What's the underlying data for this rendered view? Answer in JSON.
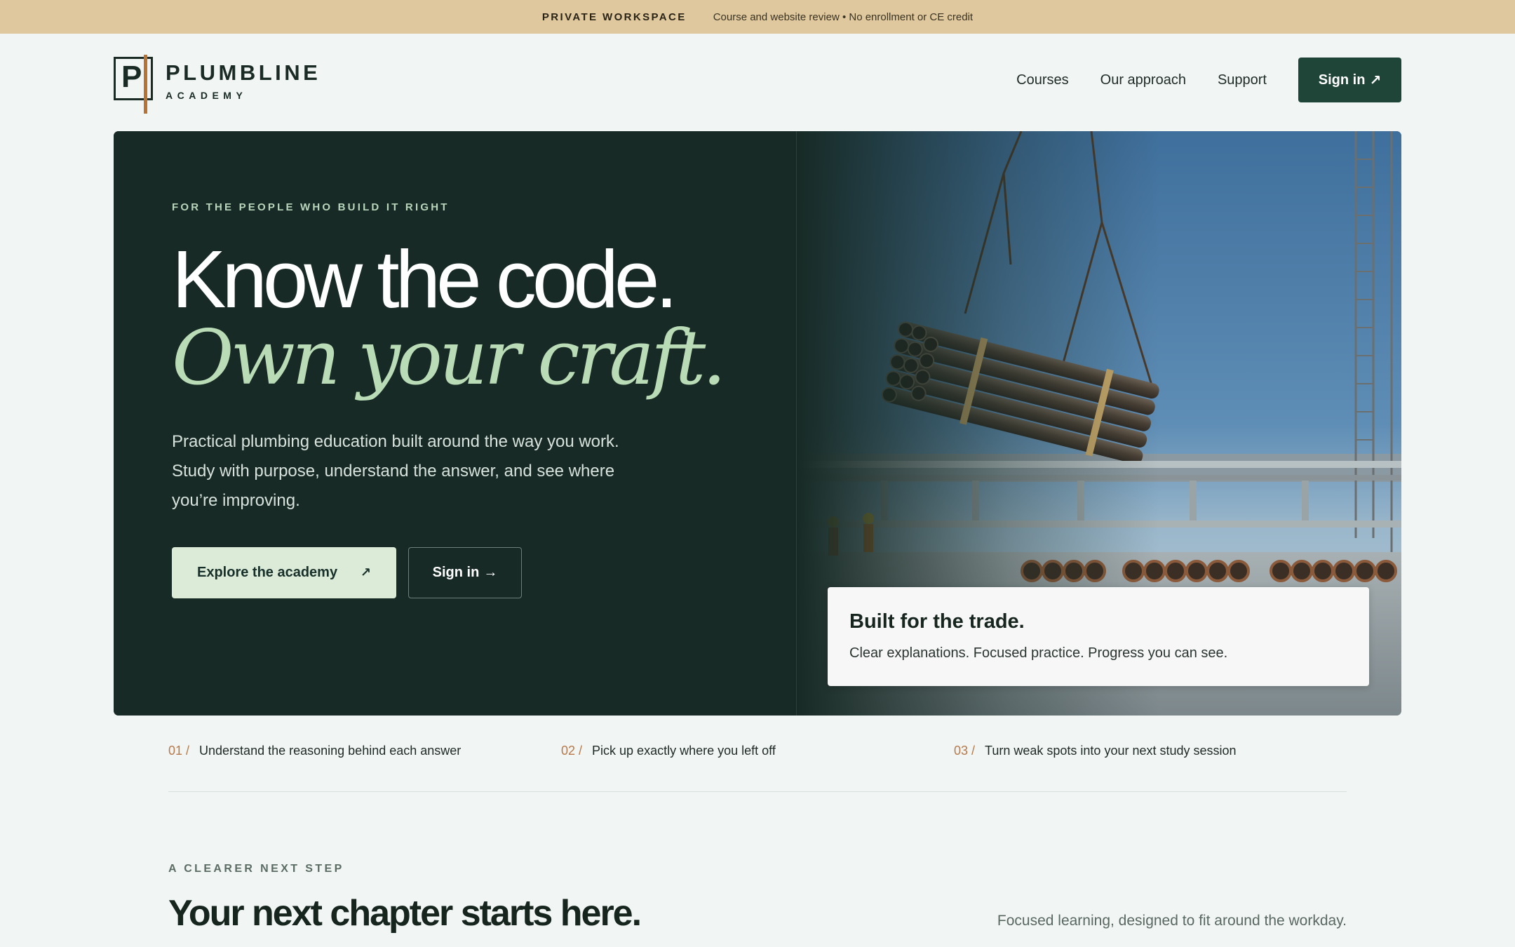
{
  "banner": {
    "title": "PRIVATE WORKSPACE",
    "subtitle": "Course and website review • No enrollment or CE credit"
  },
  "logo": {
    "mark": "P",
    "name": "PLUMBLINE",
    "sub": "ACADEMY"
  },
  "nav": {
    "items": [
      "Courses",
      "Our approach",
      "Support"
    ],
    "signin": "Sign in",
    "signin_icon": "↗"
  },
  "hero": {
    "eyebrow": "FOR THE PEOPLE WHO BUILD IT RIGHT",
    "headline_1": "Know the code.",
    "headline_2": "Own your craft.",
    "lead": "Practical plumbing education built around the way you work. Study with purpose, understand the answer, and see where you’re improving.",
    "explore_label": "Explore the academy",
    "explore_icon": "↗",
    "signin_label": "Sign in",
    "signin_icon": "→",
    "card_title": "Built for the trade.",
    "card_text": "Clear explanations. Focused practice. Progress you can see."
  },
  "steps": [
    {
      "num": "01 /",
      "text": "Understand the reasoning behind each answer"
    },
    {
      "num": "02 /",
      "text": "Pick up exactly where you left off"
    },
    {
      "num": "03 /",
      "text": "Turn weak spots into your next study session"
    }
  ],
  "section": {
    "eyebrow": "A CLEARER NEXT STEP",
    "title": "Your next chapter starts here.",
    "right": "Focused learning, designed to fit around the workday."
  },
  "colors": {
    "banner": "#dfc89e",
    "hero_bg": "#172a25",
    "accent_green": "#b9dcb7",
    "primary_button": "#1f4438",
    "copper": "#b87333"
  }
}
